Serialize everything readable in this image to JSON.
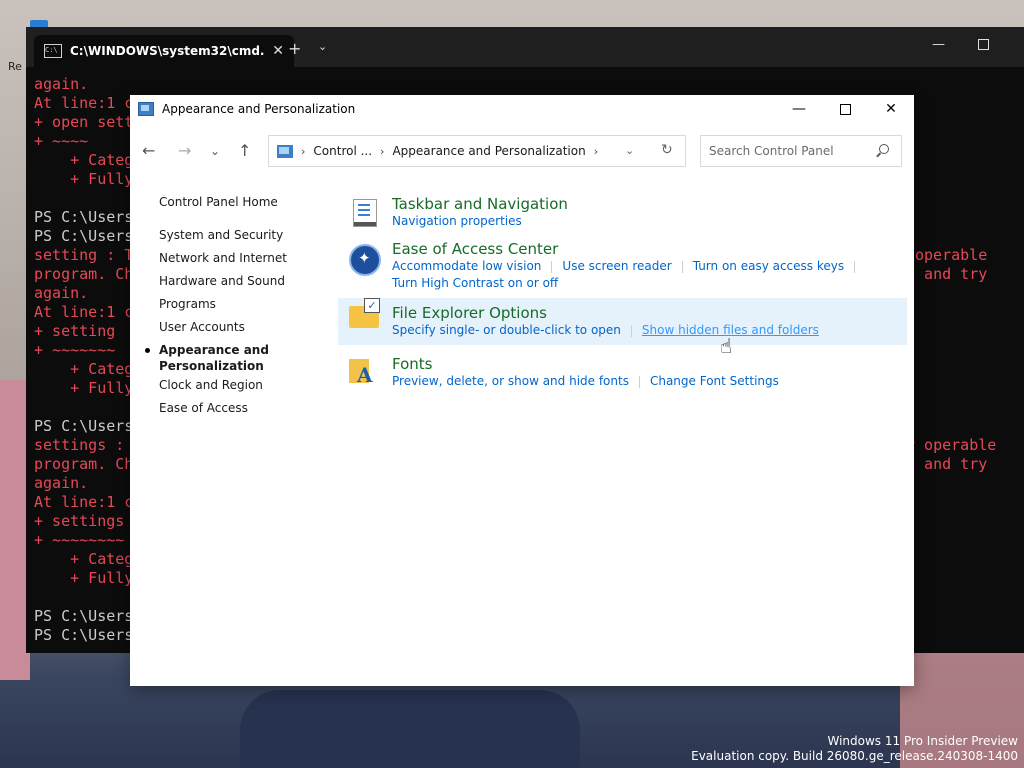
{
  "desktop": {
    "label": "Re",
    "watermark_line1": "Windows 11 Pro Insider Preview",
    "watermark_line2": "Evaluation copy. Build 26080.ge_release.240308-1400"
  },
  "terminal": {
    "tab_title": "C:\\WINDOWS\\system32\\cmd.",
    "close_glyph": "✕",
    "new_tab_glyph": "+",
    "dropdown_glyph": "⌄",
    "minimize_glyph": "—",
    "lines": [
      {
        "text": "again.",
        "color": "red"
      },
      {
        "text": "At line:1 c",
        "color": "red"
      },
      {
        "text": "+ open sett",
        "color": "red"
      },
      {
        "text": "+ ~~~~",
        "color": "red"
      },
      {
        "text": "    + Categ",
        "color": "red"
      },
      {
        "text": "    + Fully",
        "color": "red"
      },
      {
        "text": "",
        "color": "red"
      },
      {
        "text": "PS C:\\Users",
        "color": "white"
      },
      {
        "text": "PS C:\\Users",
        "color": "white"
      },
      {
        "text": "setting : T",
        "color": "red"
      },
      {
        "text": "program. Ch",
        "color": "red"
      },
      {
        "text": "again.",
        "color": "red"
      },
      {
        "text": "At line:1 c",
        "color": "red"
      },
      {
        "text": "+ setting",
        "color": "red"
      },
      {
        "text": "+ ~~~~~~~",
        "color": "red"
      },
      {
        "text": "    + Categ",
        "color": "red"
      },
      {
        "text": "    + Fully",
        "color": "red"
      },
      {
        "text": "",
        "color": "red"
      },
      {
        "text": "PS C:\\Users",
        "color": "white"
      },
      {
        "text": "settings :",
        "color": "red"
      },
      {
        "text": "program. Ch",
        "color": "red"
      },
      {
        "text": "again.",
        "color": "red"
      },
      {
        "text": "At line:1 c",
        "color": "red"
      },
      {
        "text": "+ settings",
        "color": "red"
      },
      {
        "text": "+ ~~~~~~~~",
        "color": "red"
      },
      {
        "text": "    + Categ",
        "color": "red"
      },
      {
        "text": "    + Fully",
        "color": "red"
      },
      {
        "text": "",
        "color": "red"
      },
      {
        "text": "PS C:\\Users",
        "color": "white"
      },
      {
        "text": "PS C:\\Users",
        "color": "white"
      }
    ],
    "right_1a": "operable",
    "right_1b": "t and try",
    "right_2a": "r operable",
    "right_2b": "t and try"
  },
  "control_panel": {
    "title": "Appearance and Personalization",
    "minimize_glyph": "—",
    "close_glyph": "✕",
    "nav": {
      "back": "←",
      "forward": "→",
      "recent": "⌄",
      "up": "↑"
    },
    "breadcrumb": [
      "Control ...",
      "Appearance and Personalization"
    ],
    "crumb_sep": "›",
    "address_dropdown": "⌄",
    "refresh_glyph": "↻",
    "search_placeholder": "Search Control Panel",
    "sidebar": {
      "home": "Control Panel Home",
      "items": [
        "System and Security",
        "Network and Internet",
        "Hardware and Sound",
        "Programs",
        "User Accounts"
      ],
      "active_line1": "Appearance and",
      "active_line2": "Personalization",
      "items_after": [
        "Clock and Region",
        "Ease of Access"
      ]
    },
    "categories": [
      {
        "title": "Taskbar and Navigation",
        "icon": "taskbar-icon",
        "links": [
          "Navigation properties"
        ]
      },
      {
        "title": "Ease of Access Center",
        "icon": "ease-of-access-icon",
        "links": [
          "Accommodate low vision",
          "Use screen reader",
          "Turn on easy access keys",
          "Turn High Contrast on or off"
        ]
      },
      {
        "title": "File Explorer Options",
        "icon": "folder-options-icon",
        "links": [
          "Specify single- or double-click to open",
          "Show hidden files and folders"
        ]
      },
      {
        "title": "Fonts",
        "icon": "fonts-icon",
        "links": [
          "Preview, delete, or show and hide fonts",
          "Change Font Settings"
        ]
      }
    ],
    "cursor_glyph": "☝"
  },
  "colors": {
    "accent_link": "#0066cc",
    "category_title": "#176b27",
    "highlight": "#e5f1fb",
    "error_text": "#e74856"
  }
}
